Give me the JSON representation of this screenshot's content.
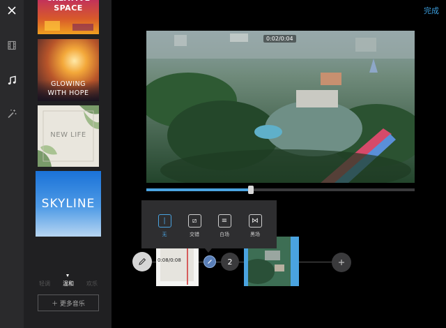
{
  "rail": {
    "icons": [
      "close-icon",
      "film-icon",
      "music-note-icon",
      "magic-wand-icon"
    ],
    "active_color": "#ffffff",
    "inactive_color": "#9a9a9a"
  },
  "themes": [
    {
      "label": "CREATIVE SPACE"
    },
    {
      "label": "GLOWING WITH HOPE"
    },
    {
      "label": "NEW LIFE"
    },
    {
      "label": "SKYLINE"
    }
  ],
  "music_styles": [
    "轻调",
    "温和",
    "欢乐"
  ],
  "music_style_selected": "温和",
  "more_music_label": "＋ 更多音乐",
  "done_label": "完成",
  "timecode": "0:02/0:04",
  "progress_fraction": 0.39,
  "transitions": [
    {
      "icon": "none-icon",
      "label": "无",
      "selected": true
    },
    {
      "icon": "crossfade-icon",
      "label": "交错",
      "selected": false
    },
    {
      "icon": "white-fade-icon",
      "label": "白场",
      "selected": false
    },
    {
      "icon": "black-fade-icon",
      "label": "黑场",
      "selected": false
    }
  ],
  "clip1_time": "0:08/0:08",
  "clip_index": "2",
  "accent_color": "#4aa3e0"
}
